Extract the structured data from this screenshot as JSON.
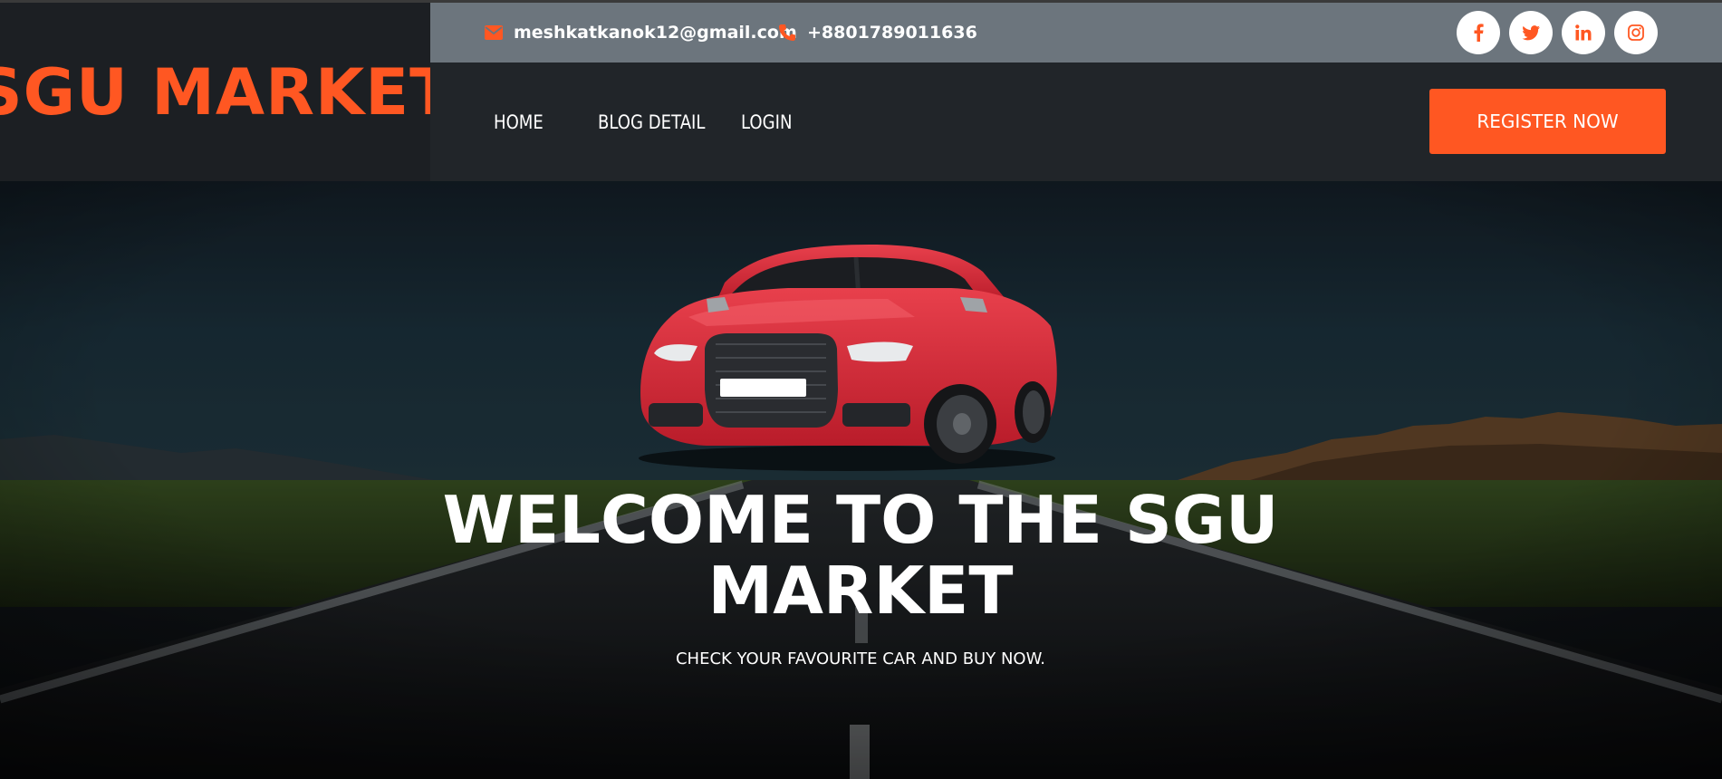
{
  "brand": {
    "title": "SGU MARKET",
    "color": "#ff5722"
  },
  "contact": {
    "email": "meshkatkanok12@gmail.com",
    "email_icon": "envelope-icon",
    "phone": "+8801789011636",
    "phone_icon": "phone-icon"
  },
  "socials": [
    {
      "name": "facebook",
      "glyph": "f"
    },
    {
      "name": "twitter",
      "glyph": "twitter"
    },
    {
      "name": "linkedin",
      "glyph": "in"
    },
    {
      "name": "instagram",
      "glyph": "instagram"
    }
  ],
  "nav": {
    "items": [
      {
        "label": "HOME"
      },
      {
        "label": "BLOG DETAIL"
      },
      {
        "label": "LOGIN"
      }
    ],
    "register_label": "REGISTER NOW"
  },
  "hero": {
    "title": "WELCOME TO THE SGU MARKET",
    "subtitle": "CHECK YOUR FAVOURITE CAR AND BUY NOW."
  },
  "colors": {
    "accent": "#ff5722",
    "contact_bar": "#6c757d",
    "navbar": "#212529",
    "brand_bg": "#1c1f23"
  }
}
